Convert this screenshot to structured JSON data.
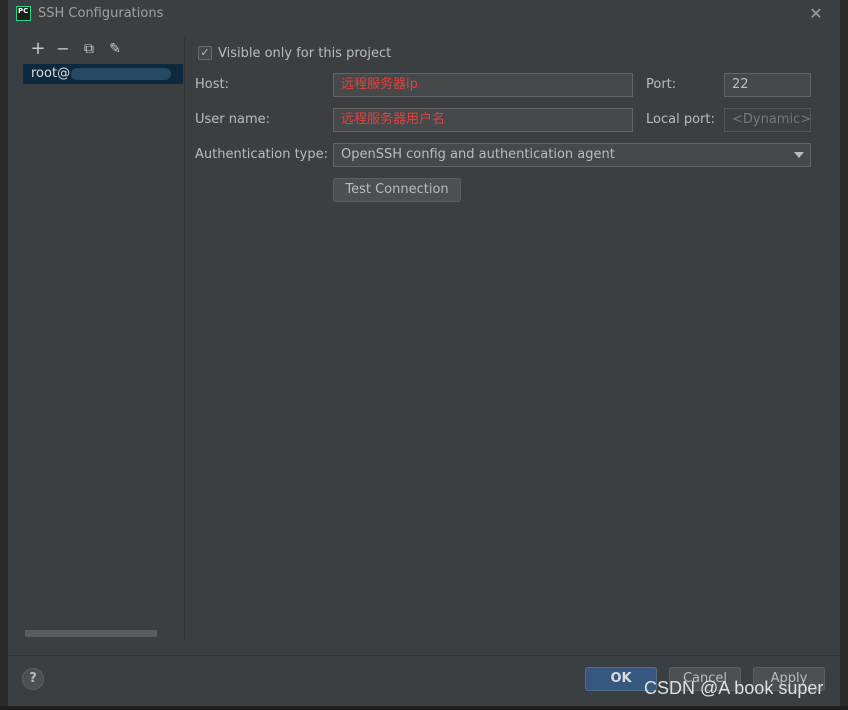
{
  "window": {
    "title": "SSH Configurations",
    "app_icon_text": "PC"
  },
  "toolbar": {
    "add": "+",
    "remove": "−",
    "copy": "⧉",
    "edit": "✎"
  },
  "configs": [
    {
      "label": "root@"
    }
  ],
  "form": {
    "visible_only_label": "Visible only for this project",
    "visible_only_checked": true,
    "host_label": "Host:",
    "host_value": "远程服务器ip",
    "port_label": "Port:",
    "port_value": "22",
    "username_label": "User name:",
    "username_value": "远程服务器用户名",
    "local_port_label": "Local port:",
    "local_port_placeholder": "<Dynamic>",
    "auth_type_label": "Authentication type:",
    "auth_type_value": "OpenSSH config and authentication agent",
    "test_button": "Test Connection"
  },
  "footer": {
    "help": "?",
    "ok": "OK",
    "cancel": "Cancel",
    "apply": "Apply"
  },
  "watermark": "CSDN @A book super",
  "colors": {
    "accent": "#365880",
    "selection": "#0d293e",
    "highlight_text": "#e24040"
  }
}
